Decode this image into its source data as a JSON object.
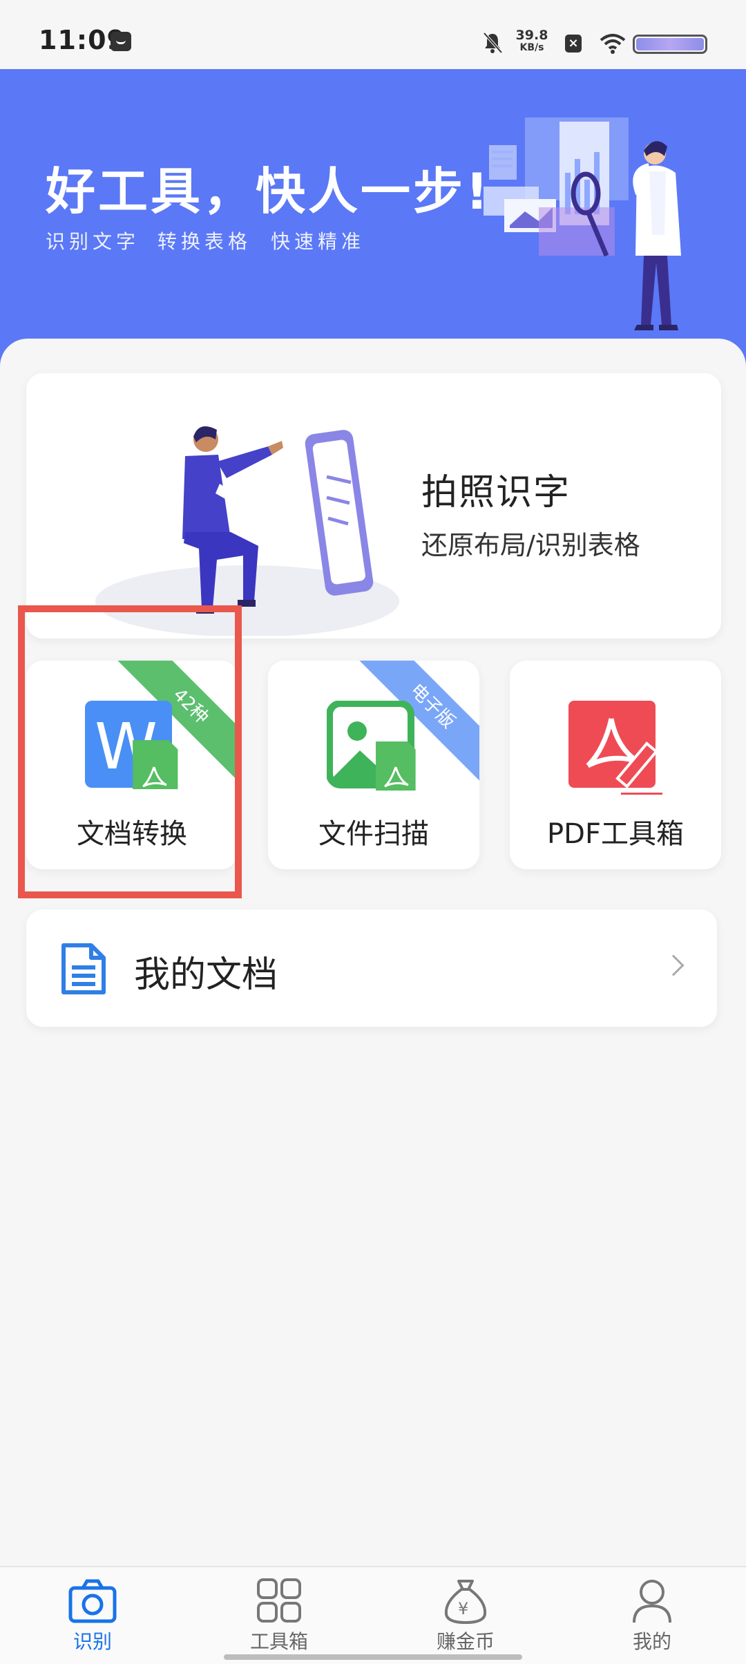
{
  "status_bar": {
    "time": "11:09",
    "net_speed_value": "39.8",
    "net_speed_unit": "KB/s",
    "icons": [
      "message-icon",
      "mute-icon",
      "sim-x-icon",
      "wifi-icon",
      "battery-icon"
    ]
  },
  "banner": {
    "title": "好工具，快人一步!",
    "features": [
      "识别文字",
      "转换表格",
      "快速精准"
    ]
  },
  "photo_card": {
    "title": "拍照识字",
    "subtitle": "还原布局/识别表格"
  },
  "tools": [
    {
      "label": "文档转换",
      "badge": "42种",
      "icon": "word-to-pdf-icon",
      "highlighted": true
    },
    {
      "label": "文件扫描",
      "badge": "电子版",
      "icon": "image-to-pdf-icon"
    },
    {
      "label": "PDF工具箱",
      "badge": "",
      "icon": "pdf-edit-icon"
    }
  ],
  "my_docs": {
    "label": "我的文档",
    "icon": "document-icon"
  },
  "bottom_nav": {
    "items": [
      {
        "label": "识别",
        "icon": "camera-icon",
        "active": true
      },
      {
        "label": "工具箱",
        "icon": "grid-icon",
        "active": false
      },
      {
        "label": "赚金币",
        "icon": "money-bag-icon",
        "active": false
      },
      {
        "label": "我的",
        "icon": "person-icon",
        "active": false
      }
    ]
  },
  "colors": {
    "banner": "#5b78f6",
    "highlight": "#e9574d",
    "active_nav": "#1a73e8",
    "badge_green": "#5bbf6e",
    "badge_blue": "#7aa6f8"
  }
}
